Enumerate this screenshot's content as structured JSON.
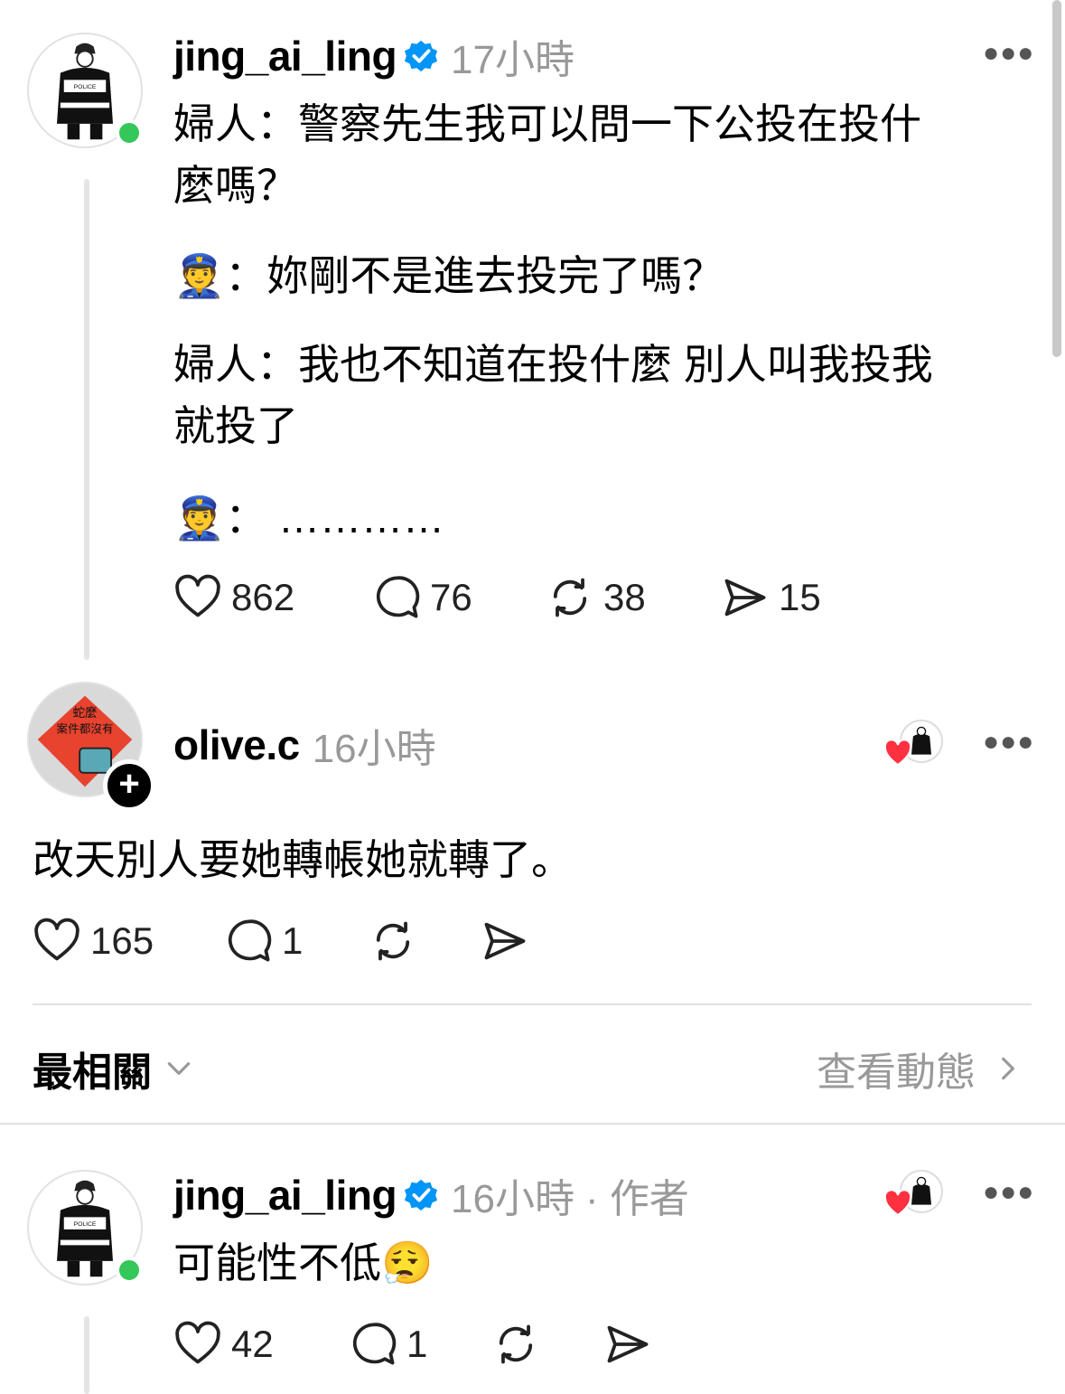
{
  "post": {
    "username": "jing_ai_ling",
    "time": "17小時",
    "lines": [
      "婦人：警察先生我可以問一下公投在投什",
      "麼嗎？",
      "👮：妳剛不是進去投完了嗎？",
      "婦人：我也不知道在投什麼 別人叫我投我",
      "就投了",
      "👮： …………"
    ],
    "likes": "862",
    "comments": "76",
    "reposts": "38",
    "shares": "15"
  },
  "reply1": {
    "username": "olive.c",
    "time": "16小時",
    "avatar_text_top": "蛇麼",
    "avatar_text_bottom": "案件都沒有",
    "text": "改天別人要她轉帳她就轉了。",
    "likes": "165",
    "comments": "1"
  },
  "sort_bar": {
    "label": "最相關",
    "view_activity": "查看動態"
  },
  "reply2": {
    "username": "jing_ai_ling",
    "time": "16小時",
    "author_tag": "· 作者",
    "text": "可能性不低😮‍💨",
    "likes": "42",
    "comments": "1"
  },
  "colors": {
    "verified": "#0095f6",
    "online": "#34c759",
    "heart": "#ff3040",
    "meta": "#999999"
  },
  "icons": [
    "heart-icon",
    "comment-icon",
    "repost-icon",
    "share-icon",
    "verified-icon",
    "more-icon",
    "chevron-down-icon",
    "chevron-right-icon"
  ]
}
